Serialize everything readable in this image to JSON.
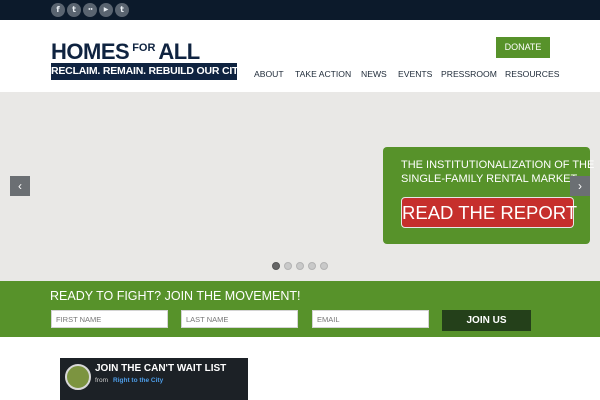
{
  "social": [
    {
      "icon": "facebook-icon",
      "glyph": "f"
    },
    {
      "icon": "twitter-icon",
      "glyph": "t"
    },
    {
      "icon": "flickr-icon",
      "glyph": "••"
    },
    {
      "icon": "youtube-icon",
      "glyph": "▶"
    },
    {
      "icon": "tumblr-icon",
      "glyph": "t"
    }
  ],
  "logo": {
    "word1": "HOMES",
    "word2": "FOR",
    "word3": "ALL",
    "tagline": "RECLAIM. REMAIN. REBUILD OUR CITIES."
  },
  "header": {
    "donate_label": "DONATE",
    "nav": [
      "ABOUT",
      "TAKE ACTION",
      "NEWS",
      "EVENTS",
      "PRESSROOM",
      "RESOURCES"
    ]
  },
  "slider": {
    "prev_glyph": "‹",
    "next_glyph": "›",
    "promo_line1": "THE INSTITUTIONALIZATION OF THE",
    "promo_line2": "SINGLE-FAMILY RENTAL MARKET",
    "button_label": "READ THE REPORT",
    "dot_count": 5,
    "active_dot": 1
  },
  "join": {
    "heading": "READY TO FIGHT? JOIN THE MOVEMENT!",
    "first_name_placeholder": "FIRST NAME",
    "last_name_placeholder": "LAST NAME",
    "email_placeholder": "EMAIL",
    "button_label": "JOIN US"
  },
  "embed": {
    "title": "JOIN THE CAN'T WAIT LIST",
    "from_label": "from",
    "source": "Right to the City"
  },
  "colors": {
    "topbar": "#0c1a2b",
    "navy": "#0f2340",
    "green": "#57922a",
    "red": "#c62f2c",
    "slider_bg": "#e9e8e6"
  }
}
